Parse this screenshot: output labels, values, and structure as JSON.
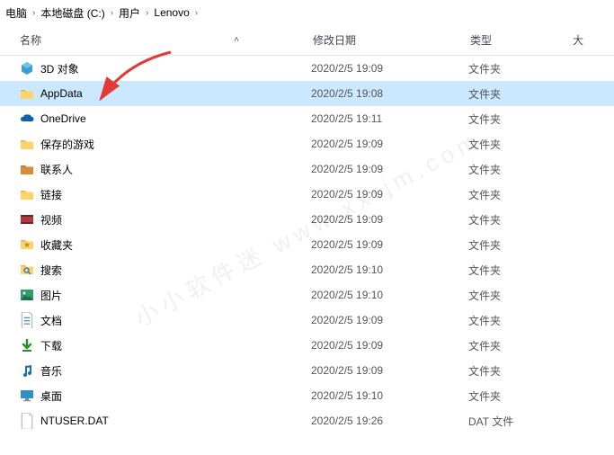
{
  "breadcrumb": {
    "items": [
      "电脑",
      "本地磁盘 (C:)",
      "用户",
      "Lenovo"
    ]
  },
  "columns": {
    "name": "名称",
    "date": "修改日期",
    "type": "类型",
    "size": "大"
  },
  "rows": [
    {
      "icon": "3d",
      "name": "3D 对象",
      "date": "2020/2/5 19:09",
      "type": "文件夹",
      "selected": false
    },
    {
      "icon": "folder",
      "name": "AppData",
      "date": "2020/2/5 19:08",
      "type": "文件夹",
      "selected": true
    },
    {
      "icon": "onedrive",
      "name": "OneDrive",
      "date": "2020/2/5 19:11",
      "type": "文件夹",
      "selected": false
    },
    {
      "icon": "games",
      "name": "保存的游戏",
      "date": "2020/2/5 19:09",
      "type": "文件夹",
      "selected": false
    },
    {
      "icon": "contacts",
      "name": "联系人",
      "date": "2020/2/5 19:09",
      "type": "文件夹",
      "selected": false
    },
    {
      "icon": "links",
      "name": "链接",
      "date": "2020/2/5 19:09",
      "type": "文件夹",
      "selected": false
    },
    {
      "icon": "videos",
      "name": "视频",
      "date": "2020/2/5 19:09",
      "type": "文件夹",
      "selected": false
    },
    {
      "icon": "fav",
      "name": "收藏夹",
      "date": "2020/2/5 19:09",
      "type": "文件夹",
      "selected": false
    },
    {
      "icon": "search",
      "name": "搜索",
      "date": "2020/2/5 19:10",
      "type": "文件夹",
      "selected": false
    },
    {
      "icon": "pictures",
      "name": "图片",
      "date": "2020/2/5 19:10",
      "type": "文件夹",
      "selected": false
    },
    {
      "icon": "docs",
      "name": "文档",
      "date": "2020/2/5 19:09",
      "type": "文件夹",
      "selected": false
    },
    {
      "icon": "down",
      "name": "下载",
      "date": "2020/2/5 19:09",
      "type": "文件夹",
      "selected": false
    },
    {
      "icon": "music",
      "name": "音乐",
      "date": "2020/2/5 19:09",
      "type": "文件夹",
      "selected": false
    },
    {
      "icon": "desktop",
      "name": "桌面",
      "date": "2020/2/5 19:10",
      "type": "文件夹",
      "selected": false
    },
    {
      "icon": "file",
      "name": "NTUSER.DAT",
      "date": "2020/2/5 19:26",
      "type": "DAT 文件",
      "selected": false
    }
  ],
  "watermark": "小小软件迷 www.xxrjm.com",
  "icon_colors": {
    "folder": "#ffd36b",
    "folder_tab": "#e6b84a",
    "3d": "#3aa0d1",
    "onedrive": "#0a64a4",
    "games": "#f0b64a",
    "contacts": "#d98a3b",
    "links": "#e6c04a",
    "videos": "#b03a3a",
    "fav": "#e6b84a",
    "search": "#3a7dc0",
    "pictures": "#2f9e6d",
    "docs": "#3882c4",
    "down": "#2a8f2a",
    "music": "#1b6fb5",
    "desktop": "#2b92c9",
    "file": "#cfd6dd"
  }
}
